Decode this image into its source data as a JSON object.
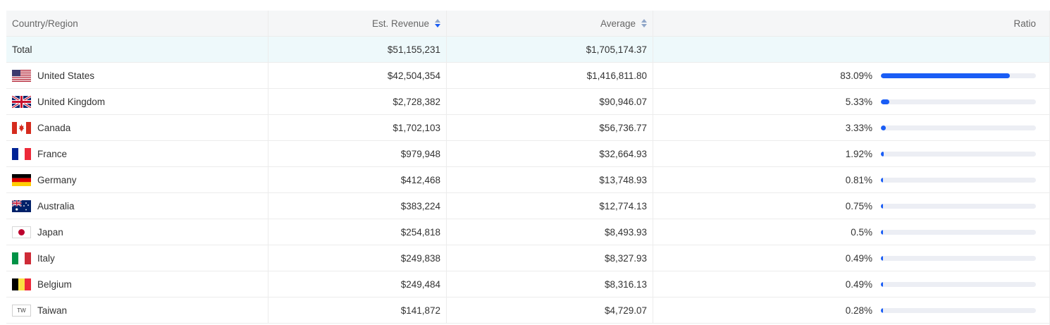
{
  "columns": {
    "country": "Country/Region",
    "revenue": "Est. Revenue",
    "average": "Average",
    "ratio": "Ratio"
  },
  "total": {
    "label": "Total",
    "revenue": "$51,155,231",
    "average": "$1,705,174.37"
  },
  "rows": [
    {
      "country": "United States",
      "flag": "us-flag-icon",
      "revenue": "$42,504,354",
      "average": "$1,416,811.80",
      "ratio": "83.09%",
      "ratio_value": 83.09
    },
    {
      "country": "United Kingdom",
      "flag": "uk-flag-icon",
      "revenue": "$2,728,382",
      "average": "$90,946.07",
      "ratio": "5.33%",
      "ratio_value": 5.33
    },
    {
      "country": "Canada",
      "flag": "canada-flag-icon",
      "revenue": "$1,702,103",
      "average": "$56,736.77",
      "ratio": "3.33%",
      "ratio_value": 3.33
    },
    {
      "country": "France",
      "flag": "france-flag-icon",
      "revenue": "$979,948",
      "average": "$32,664.93",
      "ratio": "1.92%",
      "ratio_value": 1.92
    },
    {
      "country": "Germany",
      "flag": "germany-flag-icon",
      "revenue": "$412,468",
      "average": "$13,748.93",
      "ratio": "0.81%",
      "ratio_value": 0.81
    },
    {
      "country": "Australia",
      "flag": "australia-flag-icon",
      "revenue": "$383,224",
      "average": "$12,774.13",
      "ratio": "0.75%",
      "ratio_value": 0.75
    },
    {
      "country": "Japan",
      "flag": "japan-flag-icon",
      "revenue": "$254,818",
      "average": "$8,493.93",
      "ratio": "0.5%",
      "ratio_value": 0.5
    },
    {
      "country": "Italy",
      "flag": "italy-flag-icon",
      "revenue": "$249,838",
      "average": "$8,327.93",
      "ratio": "0.49%",
      "ratio_value": 0.49
    },
    {
      "country": "Belgium",
      "flag": "belgium-flag-icon",
      "revenue": "$249,484",
      "average": "$8,316.13",
      "ratio": "0.49%",
      "ratio_value": 0.49
    },
    {
      "country": "Taiwan",
      "flag": "taiwan-flag-icon",
      "flag_text": "TW",
      "revenue": "$141,872",
      "average": "$4,729.07",
      "ratio": "0.28%",
      "ratio_value": 0.28
    }
  ],
  "colors": {
    "bar": "#1a5df5",
    "track": "#eceef4",
    "total_bg": "#eef9fb",
    "header_bg": "#f5f6f7"
  }
}
